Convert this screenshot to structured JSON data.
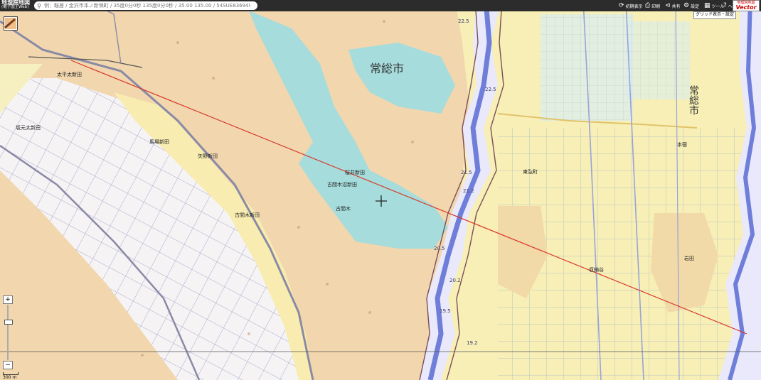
{
  "header": {
    "logo_line1": "地理院地図",
    "logo_line2": "(電子国土Web)",
    "search_placeholder": "例：鞍居 / 金沢市本ノ新保町 / 35度0分0秒 135度0分0秒 / 35.00 135.00 / 54SUE83694920",
    "initial_view_label": "初期表示",
    "print_label": "印刷",
    "share_label": "共有",
    "settings_label": "設定",
    "tools_label": "ツール",
    "help_label": "ヘルプ",
    "vector_badge_top": "地理院地図",
    "vector_badge_main": "Vector"
  },
  "grid_toggle_label": "グリッド表示・設定",
  "scale_label": "300 m",
  "zoom": {
    "in_label": "+",
    "out_label": "−",
    "level_fraction": 0.7
  },
  "map": {
    "city_labels": [
      {
        "text": "常総市"
      },
      {
        "text": "常総市"
      }
    ],
    "place_labels": [
      "太平太新田",
      "坂元太新田",
      "桜井新田",
      "古間木沼新田",
      "古間木",
      "古間木新田",
      "馬場新田",
      "矢野新田",
      "本宿",
      "東弘町",
      "収納谷",
      "岩田"
    ],
    "spot_heights": [
      "22.5",
      "22.5",
      "21.5",
      "21.2",
      "20.5",
      "20.2",
      "19.2",
      "19.5"
    ],
    "colors": {
      "upland": "#f3dcb7",
      "lowland_yellow": "#f7efb6",
      "water_cyan": "#a6dcdc",
      "river_blue": "#6f7fd9",
      "rail": "#8a8aa6",
      "route_line": "#d9382a",
      "grid": "#8a8ab0"
    }
  }
}
